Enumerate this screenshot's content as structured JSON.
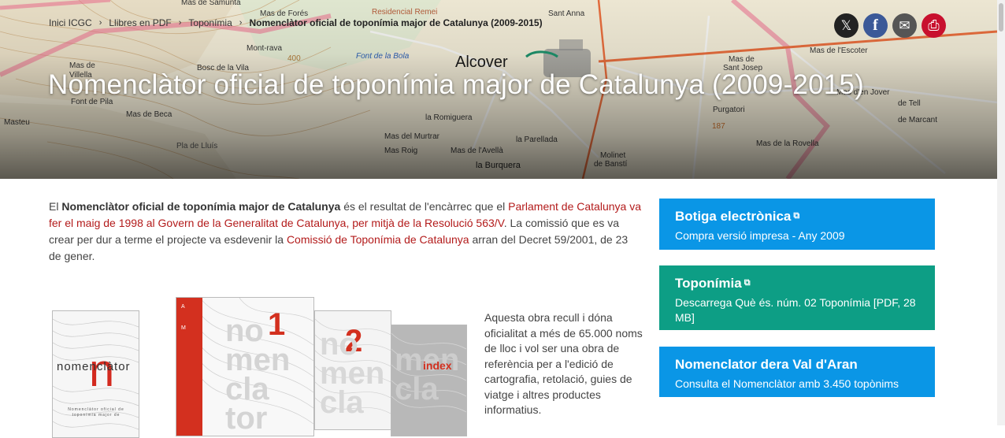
{
  "breadcrumb": {
    "items": [
      "Inici ICGC",
      "Llibres en PDF",
      "Toponímia"
    ],
    "current": "Nomenclàtor oficial de toponímia major de Catalunya (2009-2015)",
    "separator": "›"
  },
  "share": [
    {
      "name": "x-twitter-icon",
      "glyph": "𝕏",
      "color": "#222222"
    },
    {
      "name": "facebook-icon",
      "glyph": "f",
      "color": "#3b5998"
    },
    {
      "name": "email-icon",
      "glyph": "✉",
      "color": "#555555"
    },
    {
      "name": "print-icon",
      "glyph": "⎙",
      "color": "#c8102e"
    }
  ],
  "hero": {
    "title": "Nomenclàtor oficial de toponímia major de Catalunya (2009-2015)",
    "map_labels": [
      "Alcover",
      "Mas de Villella",
      "Bosc de la Vila",
      "Mont-rava",
      "Font de la Bola",
      "la Romiguera",
      "Mas del Murtrar",
      "Mas Roig",
      "Mas de l'Avellà",
      "la Parellada",
      "la Burquera",
      "Molinet de Banstí",
      "Mas de Sant Josep",
      "Mas de l'Escoter",
      "Mas d'en Jover",
      "Purgatori",
      "Mas de la Rovella",
      "Mas de Marcant",
      "Mas de Tell",
      "Mas de Forés",
      "Residencial Remei",
      "Mas de Samunta",
      "Masteu",
      "Pla de Lluís",
      "Font de Pila",
      "Mas de Beca",
      "400",
      "187",
      "Sant Anna"
    ]
  },
  "intro": {
    "p1": "El ",
    "bold": "Nomenclàtor oficial de toponímia major de Catalunya",
    "p2": " és el resultat de l'encàrrec que el ",
    "link1": "Parlament de Catalunya va fer el maig de 1998 al Govern de la Generalitat de Catalunya, per mitjà de la Resolució 563/V",
    "p3": ". La comissió que es va crear per dur a terme el projecte va esdevenir la ",
    "link2": "Comissió de Toponímia de Catalunya",
    "p4": " arran del Decret 59/2001, de 23 de gener."
  },
  "covers": {
    "cover1_word": "nomenclàtor",
    "cover1_letter": "n",
    "cover1_sub": "Nomenclàtor oficial de toponímia major de",
    "cover2_number": "1",
    "cover2_letters": [
      "A",
      "M"
    ],
    "cover3_number": "2",
    "cover4_word": "index",
    "watermark": [
      "no",
      "men",
      "cla",
      "tor"
    ]
  },
  "description": "Aquesta obra recull i dóna oficialitat a més de 65.000 noms de lloc i vol ser una obra de referència per a l'edició de cartografia, retolació, guies de viatge i altres productes informatius.",
  "cards": [
    {
      "title": "Botiga electrònica",
      "subtitle": "Compra versió impresa - Any 2009",
      "color": "#0a96e6",
      "external": "⧉"
    },
    {
      "title": "Toponímia",
      "subtitle": "Descarrega Què és. núm. 02 Toponímia [PDF, 28 MB]",
      "color": "#0d9e85",
      "external": "⧉"
    },
    {
      "title": "Nomenclator dera Val d'Aran",
      "subtitle": "Consulta el Nomenclàtor amb 3.450 topònims",
      "color": "#0a96e6",
      "external": ""
    }
  ]
}
